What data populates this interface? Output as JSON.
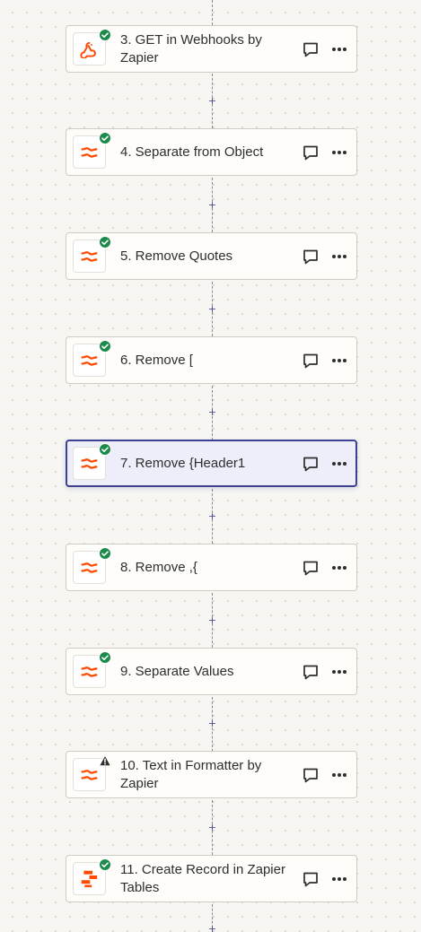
{
  "colors": {
    "accent": "#ff4a00",
    "success": "#1c8a4a",
    "warning": "#2d2e2e",
    "selected_border": "#3d4192",
    "connector": "#8a8a92"
  },
  "connectors": {
    "plus_label": "+"
  },
  "steps": [
    {
      "title": "3. GET in Webhooks by Zapier",
      "app_icon": "webhook-icon",
      "status": "success-check-icon",
      "selected": false
    },
    {
      "title": "4. Separate from Object",
      "app_icon": "formatter-icon",
      "status": "success-check-icon",
      "selected": false
    },
    {
      "title": "5. Remove Quotes",
      "app_icon": "formatter-icon",
      "status": "success-check-icon",
      "selected": false
    },
    {
      "title": "6. Remove [",
      "app_icon": "formatter-icon",
      "status": "success-check-icon",
      "selected": false
    },
    {
      "title": "7. Remove {Header1",
      "app_icon": "formatter-icon",
      "status": "success-check-icon",
      "selected": true
    },
    {
      "title": "8. Remove ,{",
      "app_icon": "formatter-icon",
      "status": "success-check-icon",
      "selected": false
    },
    {
      "title": "9. Separate Values",
      "app_icon": "formatter-icon",
      "status": "success-check-icon",
      "selected": false
    },
    {
      "title": "10. Text in Formatter by Zapier",
      "app_icon": "formatter-icon",
      "status": "warning-icon",
      "selected": false
    },
    {
      "title": "11. Create Record in Zapier Tables",
      "app_icon": "zapier-tables-icon",
      "status": "success-check-icon",
      "selected": false
    }
  ]
}
